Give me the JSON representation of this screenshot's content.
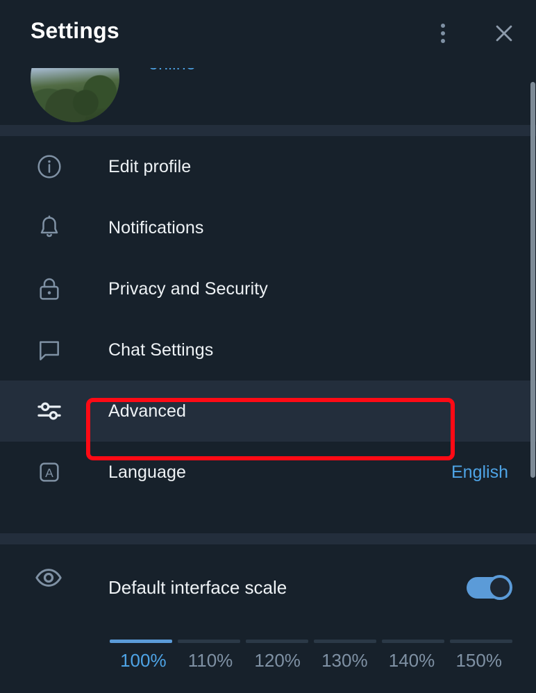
{
  "header": {
    "title": "Settings",
    "menu_icon": "more-vertical-icon",
    "close_icon": "close-icon"
  },
  "profile": {
    "status": "online",
    "avatar": "user-avatar-photo"
  },
  "menu": {
    "items": [
      {
        "label": "Edit profile",
        "icon": "info-circle-icon",
        "value": "",
        "selected": false
      },
      {
        "label": "Notifications",
        "icon": "bell-icon",
        "value": "",
        "selected": false
      },
      {
        "label": "Privacy and Security",
        "icon": "lock-icon",
        "value": "",
        "selected": false
      },
      {
        "label": "Chat Settings",
        "icon": "chat-bubble-icon",
        "value": "",
        "selected": false
      },
      {
        "label": "Advanced",
        "icon": "sliders-icon",
        "value": "",
        "selected": true
      },
      {
        "label": "Language",
        "icon": "letter-a-icon",
        "value": "English",
        "selected": false
      }
    ]
  },
  "scale": {
    "title": "Default interface scale",
    "icon": "eye-icon",
    "toggle_on": true,
    "selected_index": 0,
    "options": [
      "100%",
      "110%",
      "120%",
      "130%",
      "140%",
      "150%"
    ]
  },
  "colors": {
    "background": "#17212b",
    "selected_row": "#232e3c",
    "accent": "#4ea4e6",
    "toggle_on": "#5b9bd8",
    "annotation": "#ff0a15",
    "icon": "#7f91a4",
    "text": "#eef2f5"
  },
  "annotation": {
    "target": "Advanced",
    "shape": "red-rectangle-outline"
  }
}
